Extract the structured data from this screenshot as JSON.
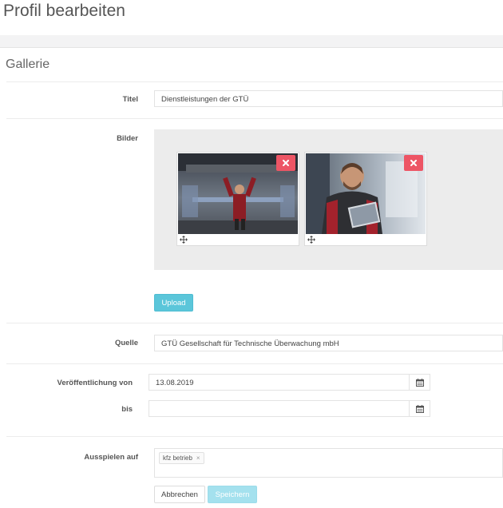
{
  "page": {
    "title": "Profil bearbeiten"
  },
  "section": {
    "title": "Gallerie"
  },
  "form": {
    "titel": {
      "label": "Titel",
      "value": "Dienstleistungen der GTÜ"
    },
    "bilder": {
      "label": "Bilder",
      "images": [
        {
          "description": "mechanic-under-car-photo",
          "delete_icon": "close-icon",
          "drag_icon": "move-icon"
        },
        {
          "description": "smiling-mechanic-tablet-photo",
          "delete_icon": "close-icon",
          "drag_icon": "move-icon"
        }
      ],
      "upload_label": "Upload"
    },
    "quelle": {
      "label": "Quelle",
      "value": "GTÜ Gesellschaft für Technische Überwachung mbH"
    },
    "veroeffentlichung": {
      "von_label": "Veröffentlichung von",
      "von_value": "13.08.2019",
      "bis_label": "bis",
      "bis_value": "",
      "calendar_icon": "calendar-icon"
    },
    "ausspielen": {
      "label": "Ausspielen auf",
      "tags": [
        {
          "text": "kfz betrieb",
          "remove": "×"
        }
      ]
    }
  },
  "actions": {
    "cancel_label": "Abbrechen",
    "save_label": "Speichern"
  },
  "colors": {
    "accent": "#5bc6da",
    "danger": "#ed5565",
    "save_disabled": "#a4e1ee"
  }
}
